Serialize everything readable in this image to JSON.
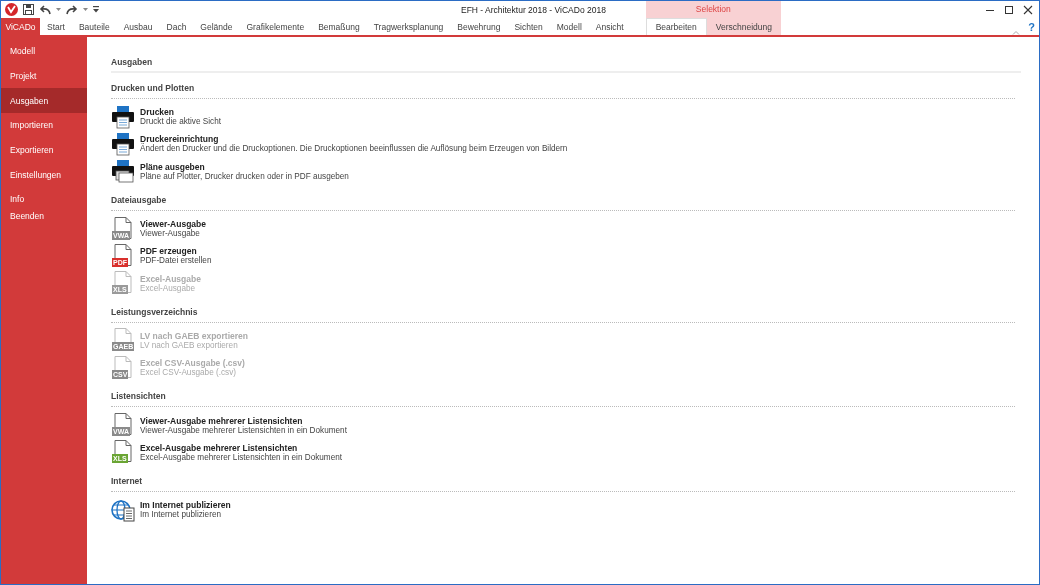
{
  "window": {
    "title": "EFH - Architektur 2018 - ViCADo 2018",
    "help": "?"
  },
  "ribbon": {
    "context_label": "Selektion",
    "tabs": [
      {
        "label": "ViCADo",
        "kind": "app",
        "selected": false
      },
      {
        "label": "Start",
        "kind": "normal",
        "selected": false
      },
      {
        "label": "Bauteile",
        "kind": "normal",
        "selected": false
      },
      {
        "label": "Ausbau",
        "kind": "normal",
        "selected": false
      },
      {
        "label": "Dach",
        "kind": "normal",
        "selected": false
      },
      {
        "label": "Gelände",
        "kind": "normal",
        "selected": false
      },
      {
        "label": "Grafikelemente",
        "kind": "normal",
        "selected": false
      },
      {
        "label": "Bemaßung",
        "kind": "normal",
        "selected": false
      },
      {
        "label": "Tragwerksplanung",
        "kind": "normal",
        "selected": false
      },
      {
        "label": "Bewehrung",
        "kind": "normal",
        "selected": false
      },
      {
        "label": "Sichten",
        "kind": "normal",
        "selected": false
      },
      {
        "label": "Modell",
        "kind": "normal",
        "selected": false
      },
      {
        "label": "Ansicht",
        "kind": "normal",
        "selected": false
      },
      {
        "label": "Bearbeiten",
        "kind": "context",
        "selected": true
      },
      {
        "label": "Verschneidung",
        "kind": "context",
        "selected": false
      }
    ]
  },
  "sidebar": {
    "items": [
      {
        "label": "Modell",
        "selected": false
      },
      {
        "label": "Projekt",
        "selected": false
      },
      {
        "label": "Ausgaben",
        "selected": true
      },
      {
        "label": "Importieren",
        "selected": false
      },
      {
        "label": "Exportieren",
        "selected": false
      },
      {
        "label": "Einstellungen",
        "selected": false
      },
      {
        "label": "Info",
        "selected": false
      },
      {
        "label": "Beenden",
        "selected": false
      }
    ]
  },
  "content": {
    "title": "Ausgaben",
    "sections": [
      {
        "heading": "Drucken und Plotten",
        "items": [
          {
            "kind": "printer",
            "title": "Drucken",
            "description": "Druckt die aktive Sicht",
            "disabled": false
          },
          {
            "kind": "printer",
            "title": "Druckereinrichtung",
            "description": "Ändert den Drucker und die Druckoptionen. Die Druckoptionen beeinflussen die Auflösung beim Erzeugen von Bildern",
            "disabled": false
          },
          {
            "kind": "plotter",
            "title": "Pläne ausgeben",
            "description": "Pläne auf Plotter, Drucker drucken oder in PDF ausgeben",
            "disabled": false
          }
        ]
      },
      {
        "heading": "Dateiausgabe",
        "items": [
          {
            "kind": "file",
            "badge": "VWA",
            "color": "#8a8a8a",
            "title": "Viewer-Ausgabe",
            "description": "Viewer-Ausgabe",
            "disabled": false
          },
          {
            "kind": "file",
            "badge": "PDF",
            "color": "#d9302c",
            "title": "PDF erzeugen",
            "description": "PDF-Datei erstellen",
            "disabled": false
          },
          {
            "kind": "file",
            "badge": "XLS",
            "color": "#9a9a9a",
            "title": "Excel-Ausgabe",
            "description": "Excel-Ausgabe",
            "disabled": true
          }
        ]
      },
      {
        "heading": "Leistungsverzeichnis",
        "items": [
          {
            "kind": "file",
            "badge": "GAEB",
            "color": "#8a8a8a",
            "title": "LV nach GAEB exportieren",
            "description": "LV nach GAEB exportieren",
            "disabled": true
          },
          {
            "kind": "file",
            "badge": "CSV",
            "color": "#8a8a8a",
            "title": "Excel CSV-Ausgabe (.csv)",
            "description": "Excel CSV-Ausgabe (.csv)",
            "disabled": true
          }
        ]
      },
      {
        "heading": "Listensichten",
        "items": [
          {
            "kind": "file",
            "badge": "VWA",
            "color": "#8a8a8a",
            "title": "Viewer-Ausgabe mehrerer Listensichten",
            "description": "Viewer-Ausgabe mehrerer Listensichten in ein Dokument",
            "disabled": false
          },
          {
            "kind": "file",
            "badge": "XLS",
            "color": "#6aa533",
            "title": "Excel-Ausgabe mehrerer Listensichten",
            "description": "Excel-Ausgabe mehrerer Listensichten in ein Dokument",
            "disabled": false
          }
        ]
      },
      {
        "heading": "Internet",
        "items": [
          {
            "kind": "globe",
            "title": "Im Internet publizieren",
            "description": "Im Internet publizieren",
            "disabled": false
          }
        ]
      }
    ]
  }
}
